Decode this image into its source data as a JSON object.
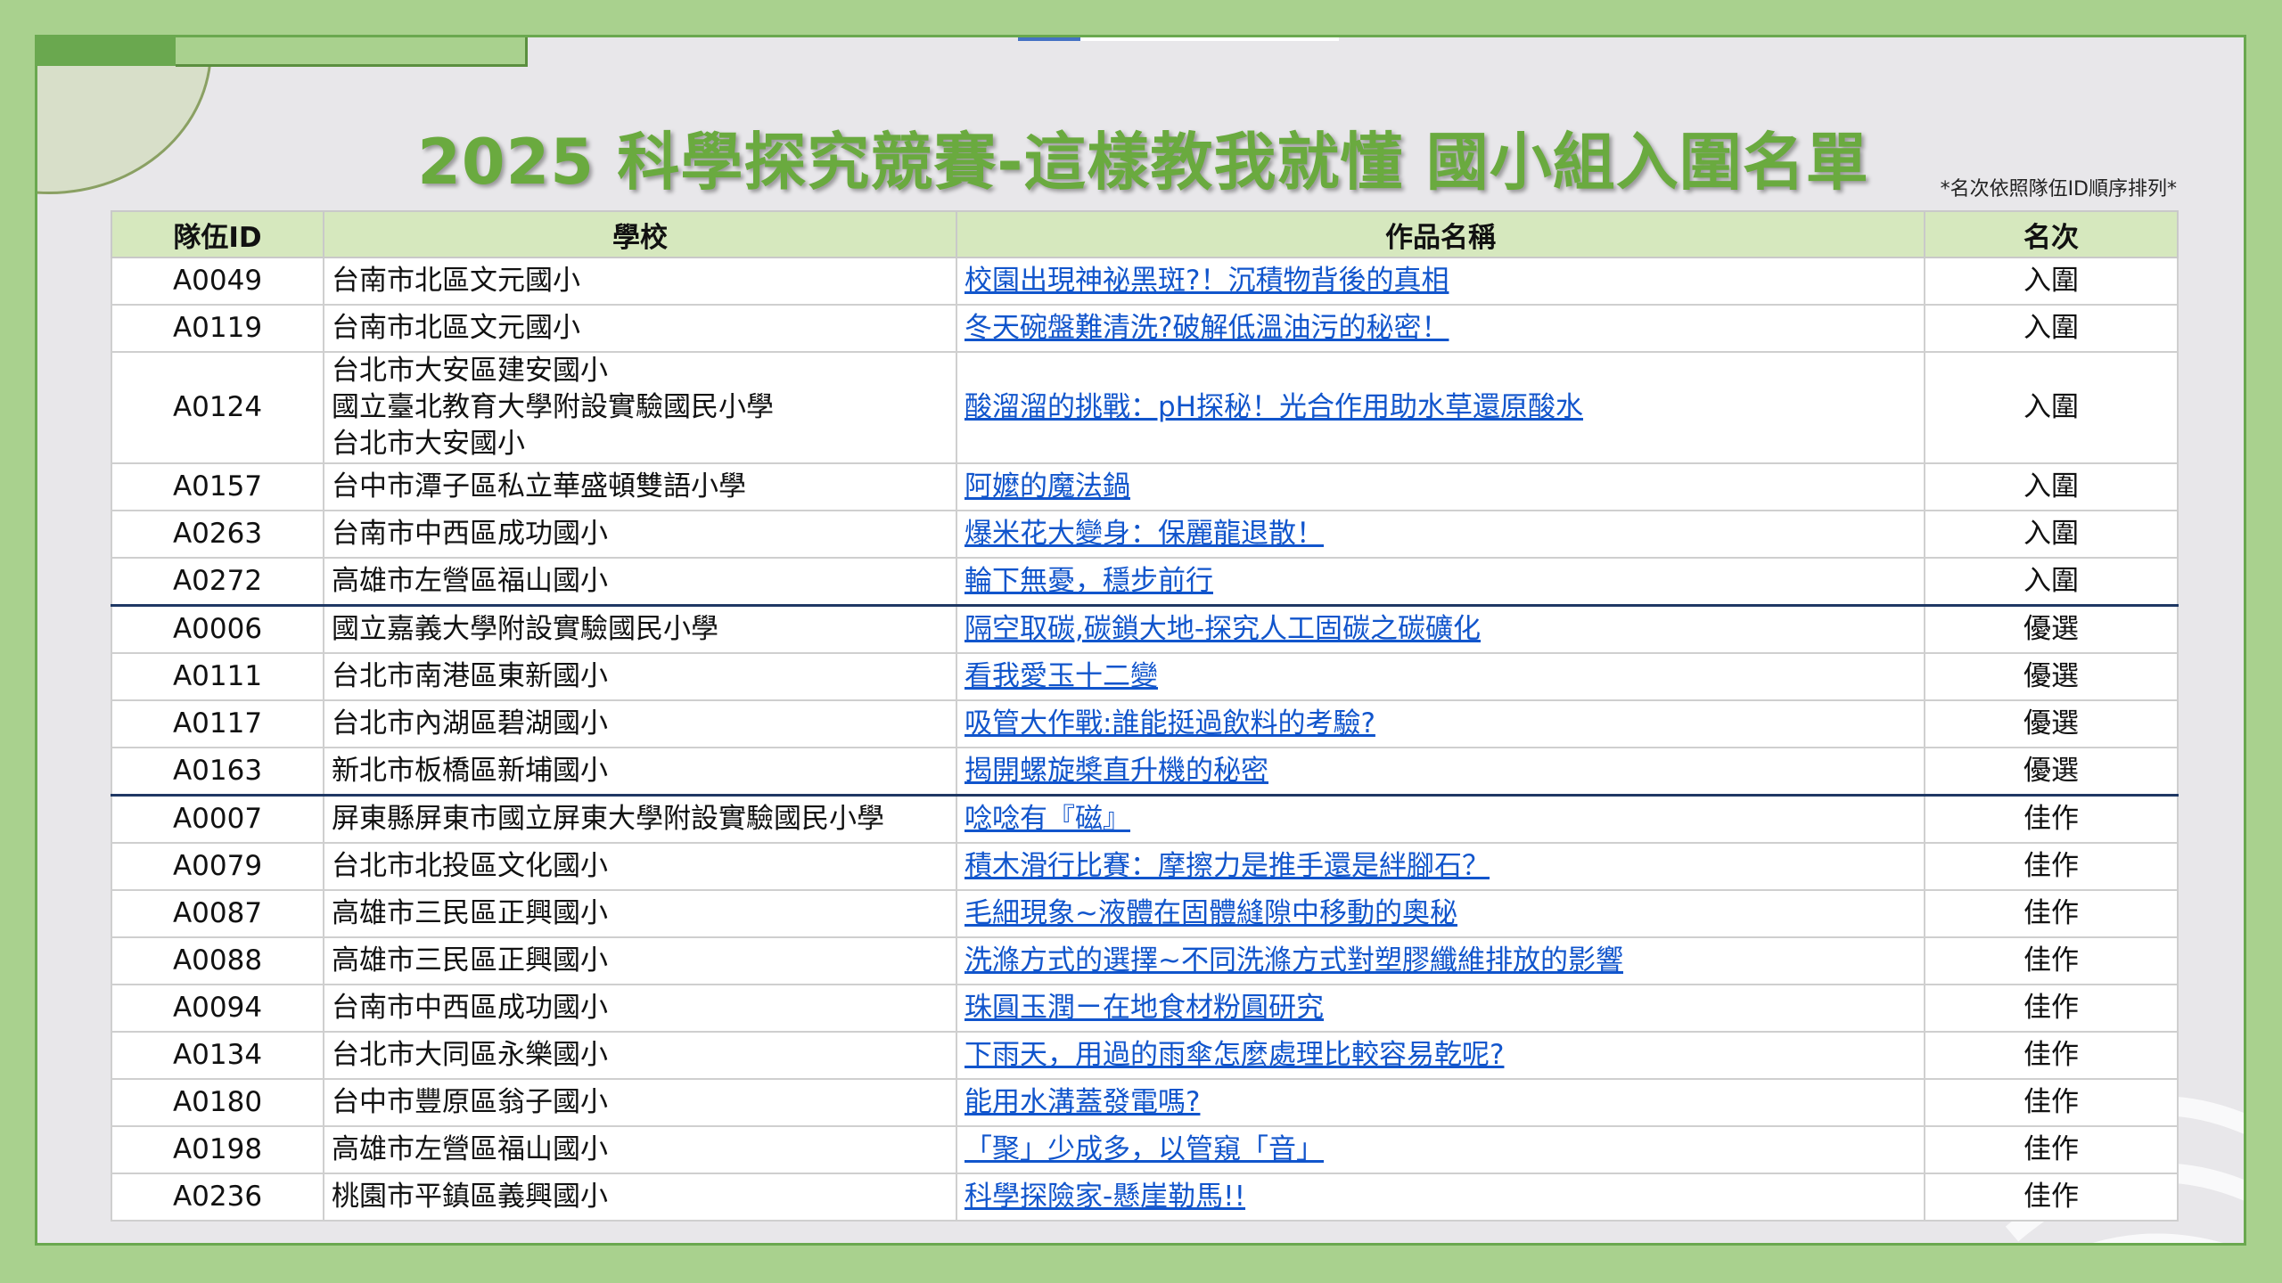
{
  "title": "2025 科學探究競賽-這樣教我就懂 國小組入圍名單",
  "note": "*名次依照隊伍ID順序排列*",
  "colors": {
    "title": "#6aaa3f",
    "header_bg": "#d6e8be",
    "link": "#1155cc",
    "frame": "#a9d18e",
    "group_divider": "#1f3864"
  },
  "columns": [
    "隊伍ID",
    "學校",
    "作品名稱",
    "名次"
  ],
  "rows": [
    {
      "id": "A0049",
      "school": [
        "台南市北區文元國小"
      ],
      "work": "校園出現神祕黑斑?！沉積物背後的真相",
      "rank": "入圍"
    },
    {
      "id": "A0119",
      "school": [
        "台南市北區文元國小"
      ],
      "work": "冬天碗盤難清洗?破解低溫油污的秘密！",
      "rank": "入圍"
    },
    {
      "id": "A0124",
      "school": [
        "台北市大安區建安國小",
        "國立臺北教育大學附設實驗國民小學",
        "台北市大安國小"
      ],
      "work": "酸溜溜的挑戰：pH探秘！光合作用助水草還原酸水",
      "rank": "入圍"
    },
    {
      "id": "A0157",
      "school": [
        "台中市潭子區私立華盛頓雙語小學"
      ],
      "work": "阿嬤的魔法鍋",
      "rank": "入圍"
    },
    {
      "id": "A0263",
      "school": [
        "台南市中西區成功國小"
      ],
      "work": "爆米花大變身：保麗龍退散！",
      "rank": "入圍"
    },
    {
      "id": "A0272",
      "school": [
        "高雄市左營區福山國小"
      ],
      "work": "輪下無憂，穩步前行",
      "rank": "入圍"
    },
    {
      "id": "A0006",
      "school": [
        "國立嘉義大學附設實驗國民小學"
      ],
      "work": "隔空取碳,碳鎖大地-探究人工固碳之碳礦化",
      "rank": "優選",
      "group_start": true
    },
    {
      "id": "A0111",
      "school": [
        "台北市南港區東新國小"
      ],
      "work": "看我愛玉十二變",
      "rank": "優選"
    },
    {
      "id": "A0117",
      "school": [
        "台北市內湖區碧湖國小"
      ],
      "work": "吸管大作戰:誰能挺過飲料的考驗?",
      "rank": "優選"
    },
    {
      "id": "A0163",
      "school": [
        "新北市板橋區新埔國小"
      ],
      "work": "揭開螺旋槳直升機的秘密",
      "rank": "優選"
    },
    {
      "id": "A0007",
      "school": [
        "屏東縣屏東市國立屏東大學附設實驗國民小學"
      ],
      "work": "唸唸有『磁』",
      "rank": "佳作",
      "group_start": true
    },
    {
      "id": "A0079",
      "school": [
        "台北市北投區文化國小"
      ],
      "work": "積木滑行比賽：摩擦力是推手還是絆腳石？",
      "rank": "佳作"
    },
    {
      "id": "A0087",
      "school": [
        "高雄市三民區正興國小"
      ],
      "work": "毛細現象~液體在固體縫隙中移動的奧秘",
      "rank": "佳作"
    },
    {
      "id": "A0088",
      "school": [
        "高雄市三民區正興國小"
      ],
      "work": "洗滌方式的選擇~不同洗滌方式對塑膠纖維排放的影響",
      "rank": "佳作"
    },
    {
      "id": "A0094",
      "school": [
        "台南市中西區成功國小"
      ],
      "work": "珠圓玉潤ㄧ在地食材粉圓研究",
      "rank": "佳作"
    },
    {
      "id": "A0134",
      "school": [
        "台北市大同區永樂國小"
      ],
      "work": "下雨天，用過的雨傘怎麼處理比較容易乾呢?",
      "rank": "佳作"
    },
    {
      "id": "A0180",
      "school": [
        "台中市豐原區翁子國小"
      ],
      "work": "能用水溝蓋發電嗎?",
      "rank": "佳作"
    },
    {
      "id": "A0198",
      "school": [
        "高雄市左營區福山國小"
      ],
      "work": "「聚」少成多，以管窺「音」",
      "rank": "佳作"
    },
    {
      "id": "A0236",
      "school": [
        "桃園市平鎮區義興國小"
      ],
      "work": "科學探險家-懸崖勒馬!!",
      "rank": "佳作"
    }
  ]
}
